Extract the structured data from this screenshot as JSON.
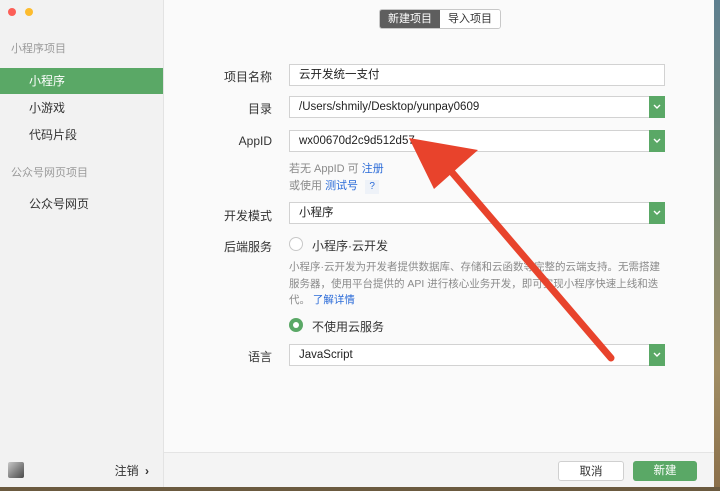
{
  "sidebar": {
    "section_mini": "小程序项目",
    "items_mini": [
      {
        "label": "小程序",
        "active": true
      },
      {
        "label": "小游戏",
        "active": false
      },
      {
        "label": "代码片段",
        "active": false
      }
    ],
    "section_oa": "公众号网页项目",
    "items_oa": [
      {
        "label": "公众号网页",
        "active": false
      }
    ],
    "logout_label": "注销",
    "logout_chevron": "›"
  },
  "tabs": {
    "new_project": "新建项目",
    "import_project": "导入项目"
  },
  "form": {
    "name_label": "项目名称",
    "name_value": "云开发统一支付",
    "dir_label": "目录",
    "dir_value": "/Users/shmily/Desktop/yunpay0609",
    "appid_label": "AppID",
    "appid_value": "wx00670d2c9d512d57",
    "hint_no_appid": "若无 AppID 可",
    "hint_register": "注册",
    "hint_or_use": "或使用",
    "hint_test_account": "测试号",
    "hint_help": "?",
    "mode_label": "开发模式",
    "mode_value": "小程序",
    "backend_label": "后端服务",
    "backend_option_cloud": "小程序·云开发",
    "backend_desc": "小程序·云开发为开发者提供数据库、存储和云函数等完整的云端支持。无需搭建服务器，使用平台提供的 API 进行核心业务开发，即可实现小程序快速上线和迭代。",
    "backend_learn_more": "了解详情",
    "backend_option_none": "不使用云服务",
    "backend_selected": "none",
    "lang_label": "语言",
    "lang_value": "JavaScript"
  },
  "footer": {
    "cancel_label": "取消",
    "create_label": "新建"
  },
  "colors": {
    "accent": "#5aa866",
    "link": "#2b6bd8",
    "annotation_arrow": "#e8432c"
  }
}
